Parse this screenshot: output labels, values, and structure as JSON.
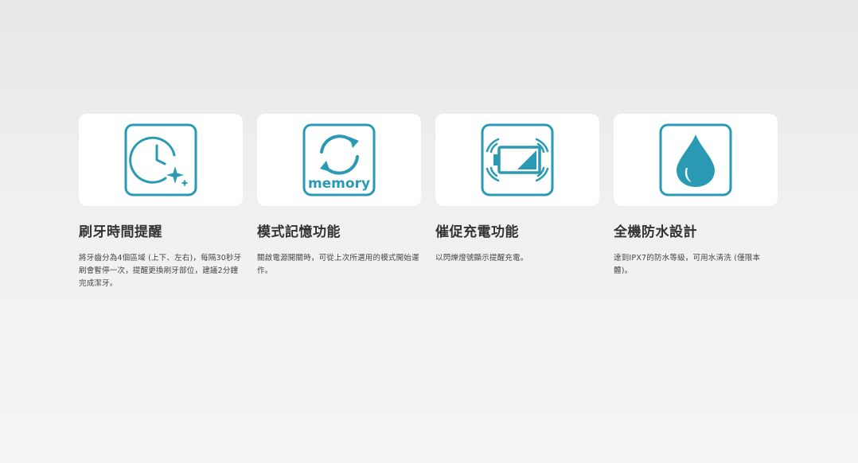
{
  "features": [
    {
      "icon": "timer-reminder-icon",
      "title": "刷牙時間提醒",
      "description": "將牙齒分為4個區域 (上下、左右)，每隔30秒牙刷會暫停一次，提醒更換刷牙部位，建議2分鐘完成潔牙。"
    },
    {
      "icon": "memory-mode-icon",
      "icon_label": "memory",
      "title": "模式記憶功能",
      "description": "關啟電源開關時，可從上次所選用的模式開始運作。"
    },
    {
      "icon": "low-battery-icon",
      "title": "催促充電功能",
      "description": "以閃爍燈號顯示提醒充電。"
    },
    {
      "icon": "water-drop-icon",
      "title": "全機防水設計",
      "description": "達到IPX7的防水等級，可用水清洗 (僅限本體)。"
    }
  ],
  "colors": {
    "accent": "#2a9ab4",
    "card": "#ffffff",
    "title": "#333333",
    "text": "#444444"
  }
}
